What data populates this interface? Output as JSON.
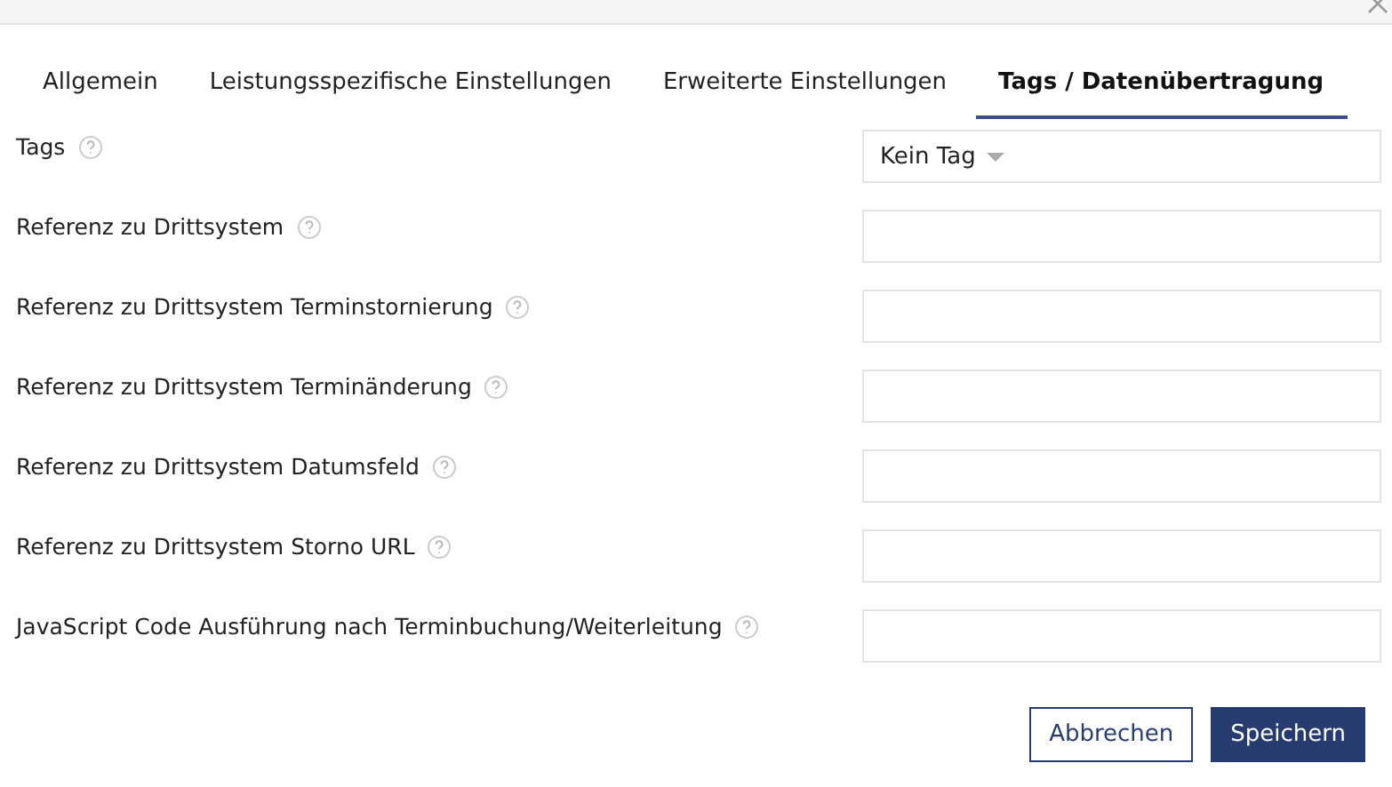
{
  "tabs": [
    {
      "label": "Allgemein",
      "selected": false
    },
    {
      "label": "Leistungsspezifische Einstellungen",
      "selected": false
    },
    {
      "label": "Erweiterte Einstellungen",
      "selected": false
    },
    {
      "label": "Tags / Datenübertragung",
      "selected": true
    }
  ],
  "fields": [
    {
      "label": "Tags",
      "kind": "select",
      "value": "Kein Tag"
    },
    {
      "label": "Referenz zu Drittsystem",
      "kind": "text"
    },
    {
      "label": "Referenz zu Drittsystem Terminstornierung",
      "kind": "text"
    },
    {
      "label": "Referenz zu Drittsystem Terminänderung",
      "kind": "text"
    },
    {
      "label": "Referenz zu Drittsystem Datumsfeld",
      "kind": "text"
    },
    {
      "label": "Referenz zu Drittsystem Storno URL",
      "kind": "text"
    },
    {
      "label": "JavaScript Code Ausführung nach Terminbuchung/Weiterleitung",
      "kind": "text"
    }
  ],
  "buttons": [
    {
      "label": "Abbrechen",
      "kind": "secondary"
    },
    {
      "label": "Speichern",
      "kind": "primary"
    }
  ]
}
